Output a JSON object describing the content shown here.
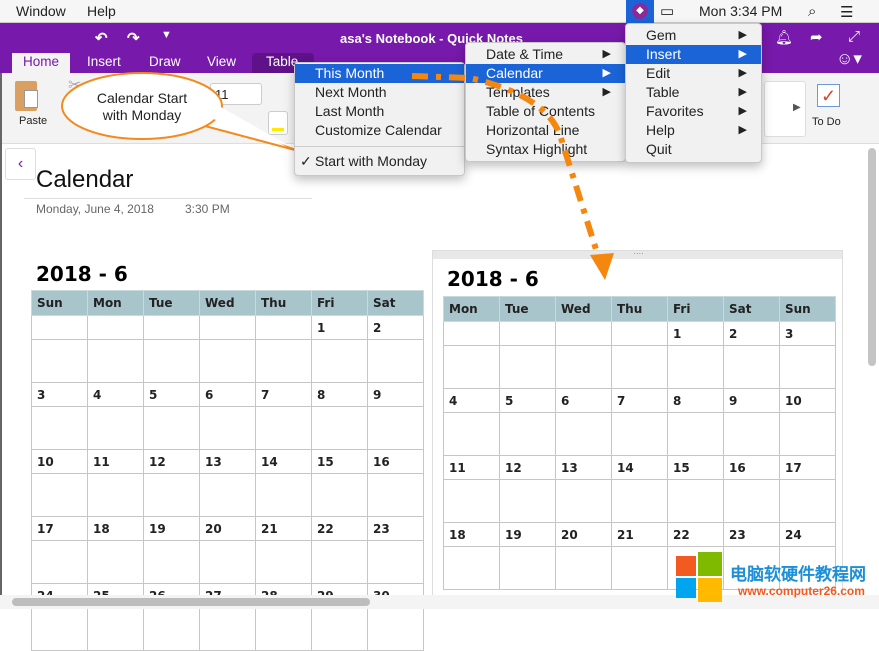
{
  "menubar": {
    "items": [
      "Window",
      "Help"
    ],
    "clock": "Mon 3:34 PM"
  },
  "window": {
    "title": "asa's Notebook - Quick Notes",
    "tabs": [
      "Home",
      "Insert",
      "Draw",
      "View",
      "Table"
    ],
    "active_tab": "Home",
    "accent": "#7719aa"
  },
  "ribbon": {
    "paste": "Paste",
    "font_size": "11",
    "todo": "To Do"
  },
  "callout": {
    "line1": "Calendar Start",
    "line2": "with Monday"
  },
  "page": {
    "title": "Calendar",
    "date": "Monday, June 4, 2018",
    "time": "3:30 PM"
  },
  "menu_calendar": {
    "items": [
      "This Month",
      "Next Month",
      "Last Month",
      "Customize Calendar"
    ],
    "checked": "Start with Monday",
    "highlighted": "This Month"
  },
  "menu_insert": {
    "items": [
      "Date & Time",
      "Calendar",
      "Templates",
      "Table of Contents",
      "Horizontal Line",
      "Syntax Highlight"
    ],
    "submenu": [
      true,
      true,
      true,
      false,
      false,
      false
    ],
    "highlighted": "Calendar"
  },
  "menu_gem": {
    "items": [
      "Gem",
      "Insert",
      "Edit",
      "Table",
      "Favorites",
      "Help",
      "Quit"
    ],
    "submenu": [
      true,
      true,
      true,
      true,
      true,
      true,
      false
    ],
    "highlighted": "Insert"
  },
  "calendar_sunday": {
    "title": "2018 - 6",
    "days": [
      "Sun",
      "Mon",
      "Tue",
      "Wed",
      "Thu",
      "Fri",
      "Sat"
    ],
    "weeks": [
      [
        "",
        "",
        "",
        "",
        "",
        "1",
        "2"
      ],
      [
        "3",
        "4",
        "5",
        "6",
        "7",
        "8",
        "9"
      ],
      [
        "10",
        "11",
        "12",
        "13",
        "14",
        "15",
        "16"
      ],
      [
        "17",
        "18",
        "19",
        "20",
        "21",
        "22",
        "23"
      ],
      [
        "24",
        "25",
        "26",
        "27",
        "28",
        "29",
        "30"
      ]
    ]
  },
  "calendar_monday": {
    "title": "2018 - 6",
    "days": [
      "Mon",
      "Tue",
      "Wed",
      "Thu",
      "Fri",
      "Sat",
      "Sun"
    ],
    "weeks": [
      [
        "",
        "",
        "",
        "",
        "1",
        "2",
        "3"
      ],
      [
        "4",
        "5",
        "6",
        "7",
        "8",
        "9",
        "10"
      ],
      [
        "11",
        "12",
        "13",
        "14",
        "15",
        "16",
        "17"
      ],
      [
        "18",
        "19",
        "20",
        "21",
        "22",
        "23",
        "24"
      ]
    ]
  },
  "watermark": {
    "line1": "电脑软硬件教程网",
    "line2": "www.computer26.com"
  }
}
